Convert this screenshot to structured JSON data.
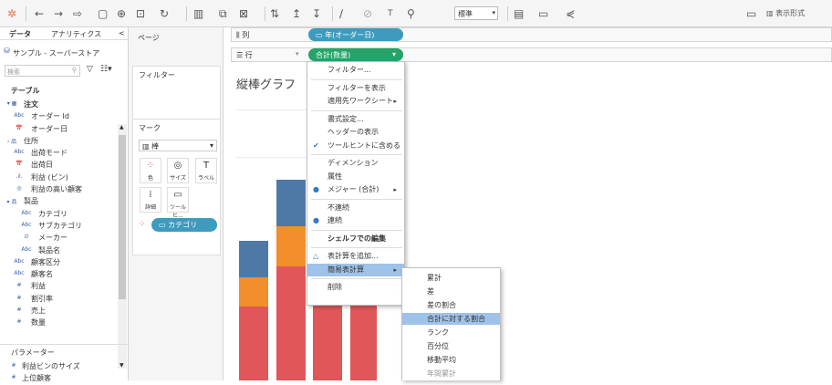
{
  "toolbar": {
    "font_select": "標準",
    "show_me_label": "表示形式"
  },
  "left": {
    "tab_data": "データ",
    "tab_analytics": "アナリティクス",
    "collapse": "<",
    "datasource": "サンプル - スーパーストア",
    "search_placeholder": "検索",
    "tables_header": "テーブル",
    "fields": [
      {
        "icon": "▾ ▦",
        "label": "注文",
        "indent": 4,
        "bold": true
      },
      {
        "icon": "Abc",
        "label": "オーダー Id",
        "indent": 12
      },
      {
        "icon": "📅",
        "label": "オーダー日",
        "indent": 12
      },
      {
        "icon": "› 品",
        "label": "住所",
        "indent": 4
      },
      {
        "icon": "Abc",
        "label": "出荷モード",
        "indent": 12
      },
      {
        "icon": "📅",
        "label": "出荷日",
        "indent": 12
      },
      {
        "icon": ".ıl.",
        "label": "利益 (ビン)",
        "indent": 12
      },
      {
        "icon": "◎",
        "label": "利益の高い顧客",
        "indent": 12
      },
      {
        "icon": "▾ 品",
        "label": "製品",
        "indent": 4
      },
      {
        "icon": "Abc",
        "label": "カテゴリ",
        "indent": 20
      },
      {
        "icon": "Abc",
        "label": "サブカテゴリ",
        "indent": 20
      },
      {
        "icon": "∅",
        "label": "メーカー",
        "indent": 20
      },
      {
        "icon": "Abc",
        "label": "製品名",
        "indent": 20
      },
      {
        "icon": "Abc",
        "label": "顧客区分",
        "indent": 12
      },
      {
        "icon": "Abc",
        "label": "顧客名",
        "indent": 12
      },
      {
        "icon": "#",
        "label": "利益",
        "indent": 12
      },
      {
        "icon": "#",
        "label": "割引率",
        "indent": 12
      },
      {
        "icon": "#",
        "label": "売上",
        "indent": 12
      },
      {
        "icon": "#",
        "label": "数量",
        "indent": 12
      }
    ],
    "params_header": "パラメーター",
    "params": [
      {
        "icon": "#",
        "label": "利益ビンのサイズ"
      },
      {
        "icon": "#",
        "label": "上位顧客"
      }
    ]
  },
  "mid": {
    "pages": "ページ",
    "filters": "フィルター",
    "marks": "マーク",
    "mark_type": "棒",
    "mark_buttons": [
      "色",
      "サイズ",
      "ラベル",
      "詳細",
      "ツールヒ..."
    ],
    "color_pill": "カテゴリ"
  },
  "shelves": {
    "columns_label": "列",
    "rows_label": "行",
    "col_pill": "年(オーダー日)",
    "row_pill": "合計(数量)"
  },
  "view": {
    "title": "縦棒グラフ"
  },
  "bars": [
    {
      "segments": [
        0.53,
        0.21,
        0.26
      ]
    },
    {
      "segments": [
        0.57,
        0.2,
        0.23
      ]
    },
    {
      "segments": [
        0.55,
        0.2,
        0.25
      ]
    },
    {
      "segments": [
        0.52,
        0.22,
        0.26
      ]
    }
  ],
  "colors": {
    "red": "#e15759",
    "orange": "#f28e2b",
    "blue": "#4e79a7",
    "green": "#59a14f",
    "pill_blue": "#3d9bbd",
    "pill_green": "#27a36a"
  },
  "context_menu": {
    "items": [
      {
        "label": "フィルター..."
      },
      {
        "sep": true
      },
      {
        "label": "フィルターを表示"
      },
      {
        "label": "適用先ワークシート",
        "sub": true
      },
      {
        "sep": true
      },
      {
        "label": "書式設定..."
      },
      {
        "label": "ヘッダーの表示"
      },
      {
        "label": "ツールヒントに含める",
        "check": "✔"
      },
      {
        "sep": true
      },
      {
        "label": "ディメンション"
      },
      {
        "label": "属性"
      },
      {
        "label": "メジャー (合計)",
        "check": "●",
        "sub": true
      },
      {
        "sep": true
      },
      {
        "label": "不連続"
      },
      {
        "label": "連続",
        "check": "●"
      },
      {
        "sep": true
      },
      {
        "label": "シェルフでの編集",
        "bold": true
      },
      {
        "sep": true
      },
      {
        "label": "表計算を追加...",
        "check": "△"
      },
      {
        "label": "簡易表計算",
        "sub": true,
        "hl": true
      },
      {
        "sep": true
      },
      {
        "label": "削除"
      }
    ]
  },
  "submenu": {
    "items": [
      {
        "label": "累計"
      },
      {
        "label": "差"
      },
      {
        "label": "差の割合"
      },
      {
        "label": "合計に対する割合",
        "hl": true
      },
      {
        "label": "ランク"
      },
      {
        "label": "百分位"
      },
      {
        "label": "移動平均"
      },
      {
        "label": "年間累計",
        "dim": true
      }
    ]
  }
}
